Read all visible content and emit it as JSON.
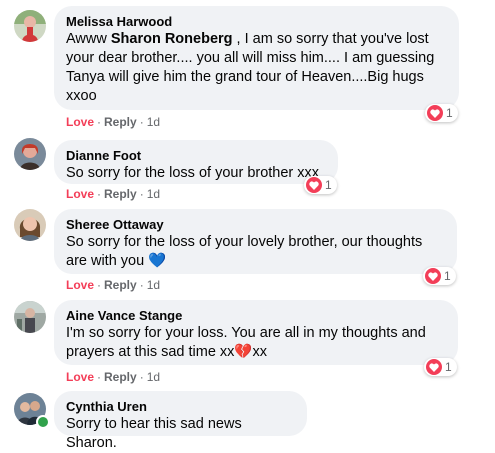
{
  "comments": [
    {
      "author": "Melissa Harwood",
      "text_before": "Awww ",
      "mention": "Sharon Roneberg",
      "text_after": " , I am so sorry that you've lost your dear brother.... you all will miss him.... I am guessing Tanya will give him the grand tour of Heaven....Big hugs xxoo",
      "reactions": "1",
      "love": "Love",
      "reply": "Reply",
      "time": "1d",
      "sep": "·"
    },
    {
      "author": "Dianne Foot",
      "text": "So sorry for the loss of your brother xxx",
      "reactions": "1",
      "love": "Love",
      "reply": "Reply",
      "time": "1d",
      "sep": "·"
    },
    {
      "author": "Sheree Ottaway",
      "text": "So sorry for the loss of your lovely brother, our thoughts are with you 💙",
      "reactions": "1",
      "love": "Love",
      "reply": "Reply",
      "time": "1d",
      "sep": "·"
    },
    {
      "author": "Aine Vance Stange",
      "text": "I'm so sorry for your loss. You are all in my thoughts and prayers at this sad time xx💔xx",
      "reactions": "1",
      "love": "Love",
      "reply": "Reply",
      "time": "1d",
      "sep": "·"
    },
    {
      "author": "Cynthia Uren",
      "text": "Sorry to hear this sad news Sharon."
    }
  ],
  "colors": {
    "bubble": "#f0f2f5",
    "love": "#f33e58",
    "meta": "#65676b",
    "online": "#31a24c"
  },
  "icons": [
    "heart-reaction-icon",
    "avatar",
    "online-status-icon"
  ]
}
